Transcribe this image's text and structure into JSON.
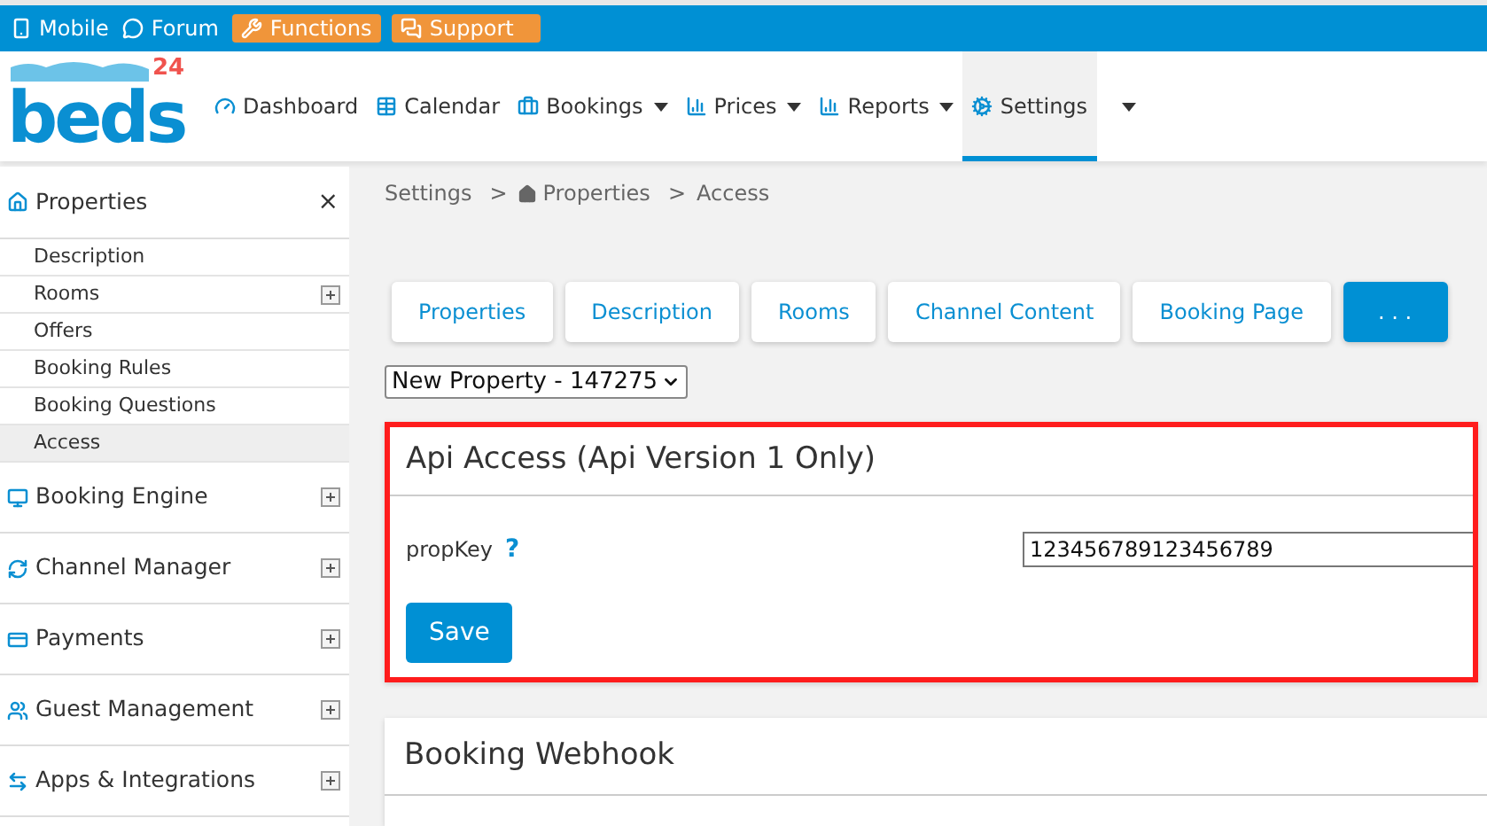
{
  "topbar": {
    "links": [
      {
        "kind": "plain",
        "label": "Mobile"
      },
      {
        "kind": "plain",
        "label": "Forum"
      },
      {
        "kind": "accent",
        "label": "Functions"
      },
      {
        "kind": "accent",
        "label": "Support"
      }
    ]
  },
  "logo": {
    "word": "beds",
    "superscript": "24"
  },
  "nav": [
    {
      "label": "Dashboard",
      "dropdown": false,
      "selected": false
    },
    {
      "label": "Calendar",
      "dropdown": false,
      "selected": false
    },
    {
      "label": "Bookings",
      "dropdown": true,
      "selected": false
    },
    {
      "label": "Prices",
      "dropdown": true,
      "selected": false
    },
    {
      "label": "Reports",
      "dropdown": true,
      "selected": false
    },
    {
      "label": "Settings",
      "dropdown": false,
      "selected": true
    }
  ],
  "sidebar": {
    "sections": [
      {
        "label": "Properties",
        "expanded": true,
        "children": [
          {
            "label": "Description",
            "expandable": false,
            "selected": false
          },
          {
            "label": "Rooms",
            "expandable": true,
            "selected": false
          },
          {
            "label": "Offers",
            "expandable": false,
            "selected": false
          },
          {
            "label": "Booking Rules",
            "expandable": false,
            "selected": false
          },
          {
            "label": "Booking Questions",
            "expandable": false,
            "selected": false
          },
          {
            "label": "Access",
            "expandable": false,
            "selected": true
          }
        ],
        "close": "×"
      },
      {
        "label": "Booking Engine",
        "expanded": false
      },
      {
        "label": "Channel Manager",
        "expanded": false
      },
      {
        "label": "Payments",
        "expanded": false
      },
      {
        "label": "Guest Management",
        "expanded": false
      },
      {
        "label": "Apps & Integrations",
        "expanded": false
      }
    ]
  },
  "breadcrumb": [
    {
      "label": "Settings",
      "home": false
    },
    {
      "label": "Properties",
      "home": true
    },
    {
      "label": "Access",
      "home": false
    }
  ],
  "breadcrumb_separator": ">",
  "tabs": [
    {
      "label": "Properties",
      "selected": false
    },
    {
      "label": "Description",
      "selected": false
    },
    {
      "label": "Rooms",
      "selected": false
    },
    {
      "label": "Channel Content",
      "selected": false
    },
    {
      "label": "Booking Page",
      "selected": false
    },
    {
      "label": ". . .",
      "selected": true
    }
  ],
  "property_select": {
    "value": "New Property - 147275"
  },
  "api_card": {
    "title": "Api Access (Api Version 1 Only)",
    "highlighted": true,
    "field_label": "propKey",
    "help": "?",
    "value": "123456789123456789",
    "button": "Save"
  },
  "webhook_card": {
    "title": "Booking Webhook"
  }
}
